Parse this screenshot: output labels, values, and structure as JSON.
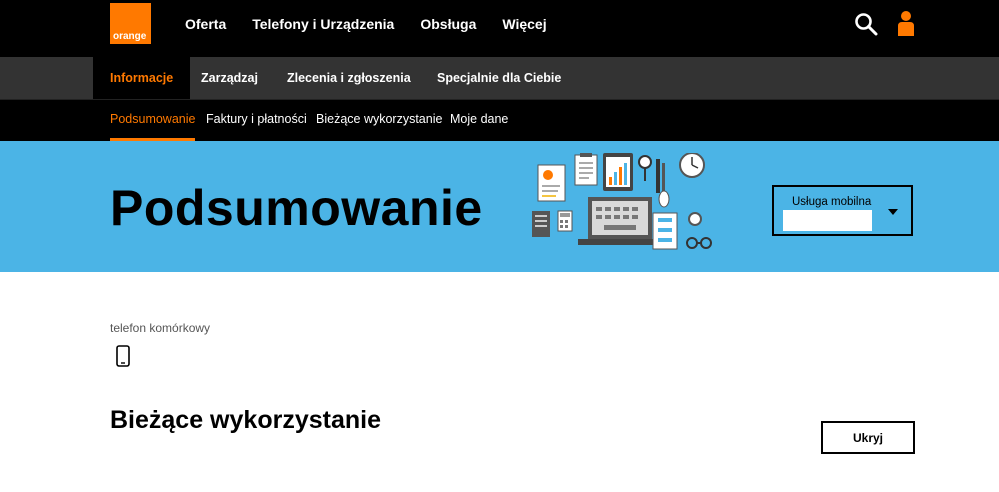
{
  "brand": {
    "logo_text": "orange",
    "accent": "#ff7900"
  },
  "main_nav": [
    "Oferta",
    "Telefony i Urządzenia",
    "Obsługa",
    "Więcej"
  ],
  "header_icons": [
    "search-icon",
    "user-icon"
  ],
  "sub_nav": [
    "Informacje",
    "Zarządzaj",
    "Zlecenia i zgłoszenia",
    "Specjalnie dla Ciebie"
  ],
  "tabs": [
    "Podsumowanie",
    "Faktury i płatności",
    "Bieżące wykorzystanie",
    "Moje dane"
  ],
  "hero": {
    "title": "Podsumowanie",
    "background": "#4bb4e6",
    "service_select": {
      "label": "Usługa mobilna",
      "value": ""
    }
  },
  "product": {
    "type": "telefon komórkowy",
    "icon": "mobile-phone-icon"
  },
  "section": {
    "title": "Bieżące wykorzystanie",
    "toggle_label": "Ukryj"
  }
}
